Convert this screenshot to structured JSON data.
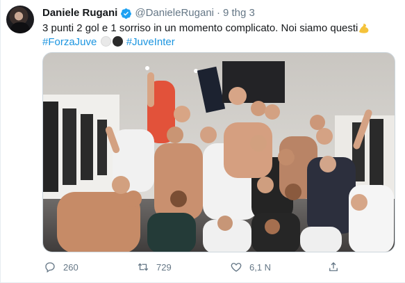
{
  "author": {
    "name": "Daniele Rugani",
    "handle": "@DanieleRugani",
    "separator": "·",
    "time": "9 thg 3"
  },
  "tweet": {
    "text": "3 punti 2 gol e 1 sorriso in un momento complicato. Noi siamo questi",
    "hashtag1": "#ForzaJuve",
    "hashtag2": "#JuveInter"
  },
  "actions": {
    "replies": "260",
    "retweets": "729",
    "likes": "6,1 N"
  },
  "colors": {
    "link": "#1b95e0",
    "secondary": "#657786",
    "verified": "#1da1f2"
  },
  "icons": [
    "verified-badge-icon",
    "flexed-biceps-emoji",
    "white-circle-emoji",
    "black-circle-emoji",
    "reply-icon",
    "retweet-icon",
    "like-icon",
    "share-icon"
  ]
}
